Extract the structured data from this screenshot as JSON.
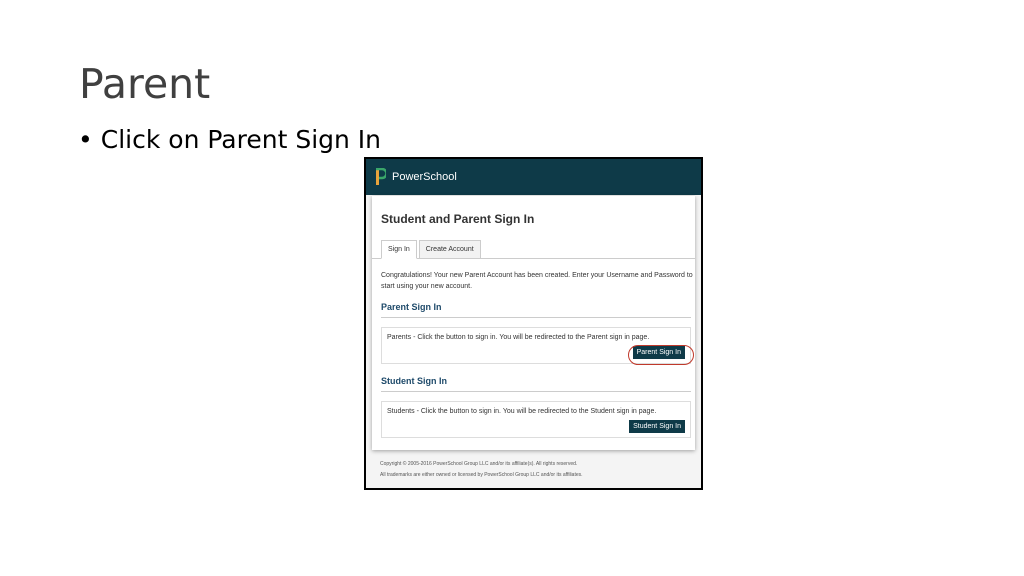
{
  "slide": {
    "title": "Parent",
    "bullet": "Click on Parent Sign In",
    "bullet_marker": "•"
  },
  "screenshot": {
    "brand": "PowerSchool",
    "page_title": "Student and Parent Sign In",
    "tabs": [
      {
        "label": "Sign In"
      },
      {
        "label": "Create Account"
      }
    ],
    "message": "Congratulations! Your new Parent Account has been created. Enter your Username and Password to start using your new account.",
    "parent": {
      "heading": "Parent Sign In",
      "text": "Parents - Click the button to sign in. You will be redirected to the Parent sign in page.",
      "button": "Parent Sign In"
    },
    "student": {
      "heading": "Student Sign In",
      "text": "Students - Click the button to sign in. You will be redirected to the Student sign in page.",
      "button": "Student Sign In"
    },
    "footer": {
      "copyright": "Copyright © 2005-2016 PowerSchool Group LLC and/or its affiliate(s). All rights reserved.",
      "trademarks": "All trademarks are either owned or licensed by PowerSchool Group LLC and/or its affiliates."
    }
  },
  "colors": {
    "header_bg": "#0e3a48",
    "heading_blue": "#1e4a6a",
    "highlight_red": "#c0392b"
  }
}
